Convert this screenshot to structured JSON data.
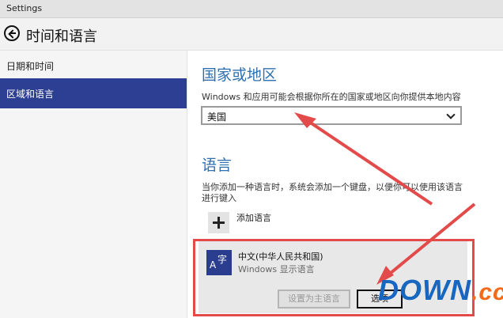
{
  "window": {
    "title": "Settings"
  },
  "header": {
    "title": "时间和语言"
  },
  "sidebar": {
    "items": [
      {
        "label": "日期和时间",
        "active": false
      },
      {
        "label": "区域和语言",
        "active": true
      }
    ]
  },
  "region": {
    "heading": "国家或地区",
    "description": "Windows 和应用可能会根据你所在的国家或地区向你提供本地内容",
    "selected": "美国"
  },
  "language": {
    "heading": "语言",
    "description_line1": "当你添加一种语言时，系统会添加一个键盘，以便你可以使用该语言",
    "description_line2": "进行键入",
    "add_label": "添加语言",
    "entry": {
      "icon_glyph_a": "A",
      "icon_glyph_b": "字",
      "name": "中文(中华人民共和国)",
      "subtitle": "Windows 显示语言"
    },
    "set_primary_label": "设置为主语言",
    "options_label": "选项"
  },
  "watermark": {
    "text": "DOWN",
    "tld": ".cc"
  },
  "colors": {
    "accent": "#2d3f93",
    "heading": "#2e6fb0",
    "annotation_red": "#e34b4b",
    "watermark_blue": "#1766c0",
    "watermark_orange": "#f36a1a"
  }
}
